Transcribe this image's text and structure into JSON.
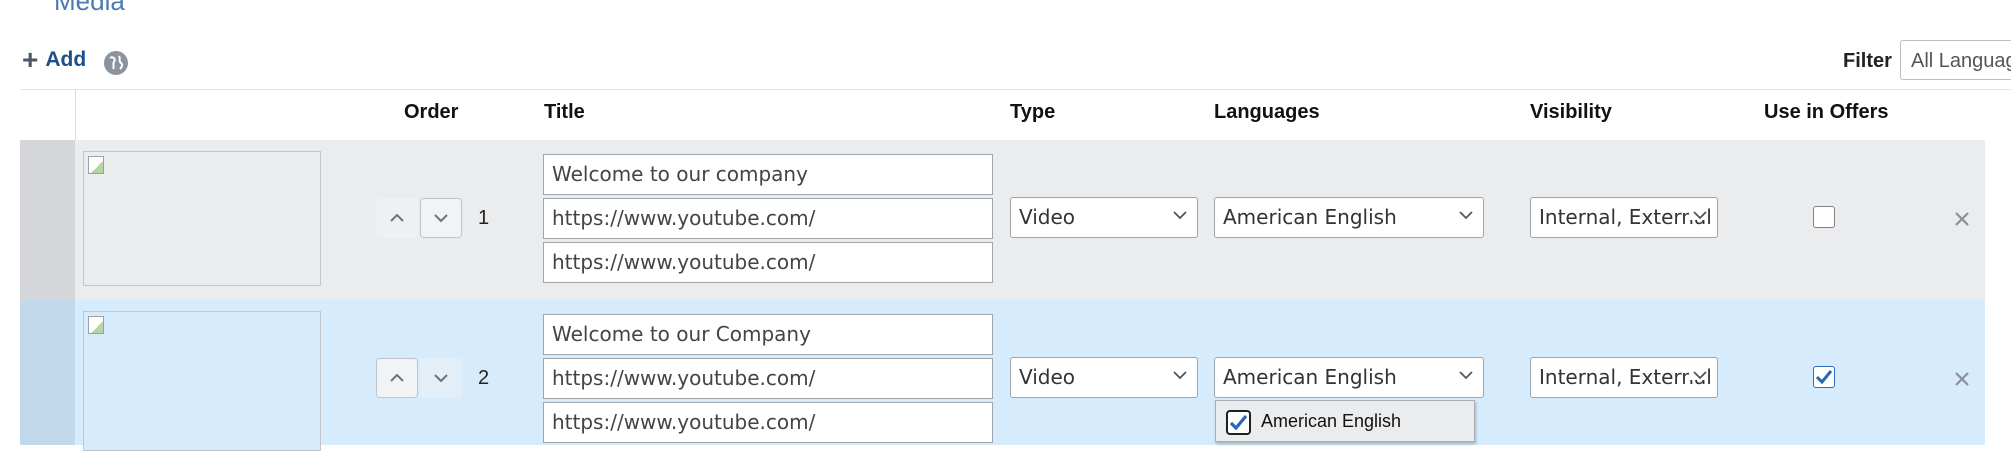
{
  "section": {
    "title": "Media"
  },
  "toolbar": {
    "add_label": "Add",
    "filter_label": "Filter",
    "filter_value": "All Languages"
  },
  "columns": {
    "order": "Order",
    "title": "Title",
    "type": "Type",
    "languages": "Languages",
    "visibility": "Visibility",
    "use_in_offers": "Use in Offers"
  },
  "rows": [
    {
      "order": "1",
      "title": "Welcome to our company",
      "url1": "https://www.youtube.com/",
      "url2": "https://www.youtube.com/",
      "type": "Video",
      "languages": "American English",
      "visibility": "Internal, External",
      "use_in_offers": false
    },
    {
      "order": "2",
      "title": "Welcome to our Company",
      "url1": "https://www.youtube.com/",
      "url2": "https://www.youtube.com/",
      "type": "Video",
      "languages": "American English",
      "visibility": "Internal, External",
      "use_in_offers": true
    }
  ],
  "languages_dropdown": {
    "option": "American English",
    "checked": true
  },
  "icons": {
    "add": "plus-icon",
    "globe": "globe-icon",
    "up": "chevron-up-icon",
    "down": "chevron-down-icon",
    "delete": "close-icon"
  }
}
